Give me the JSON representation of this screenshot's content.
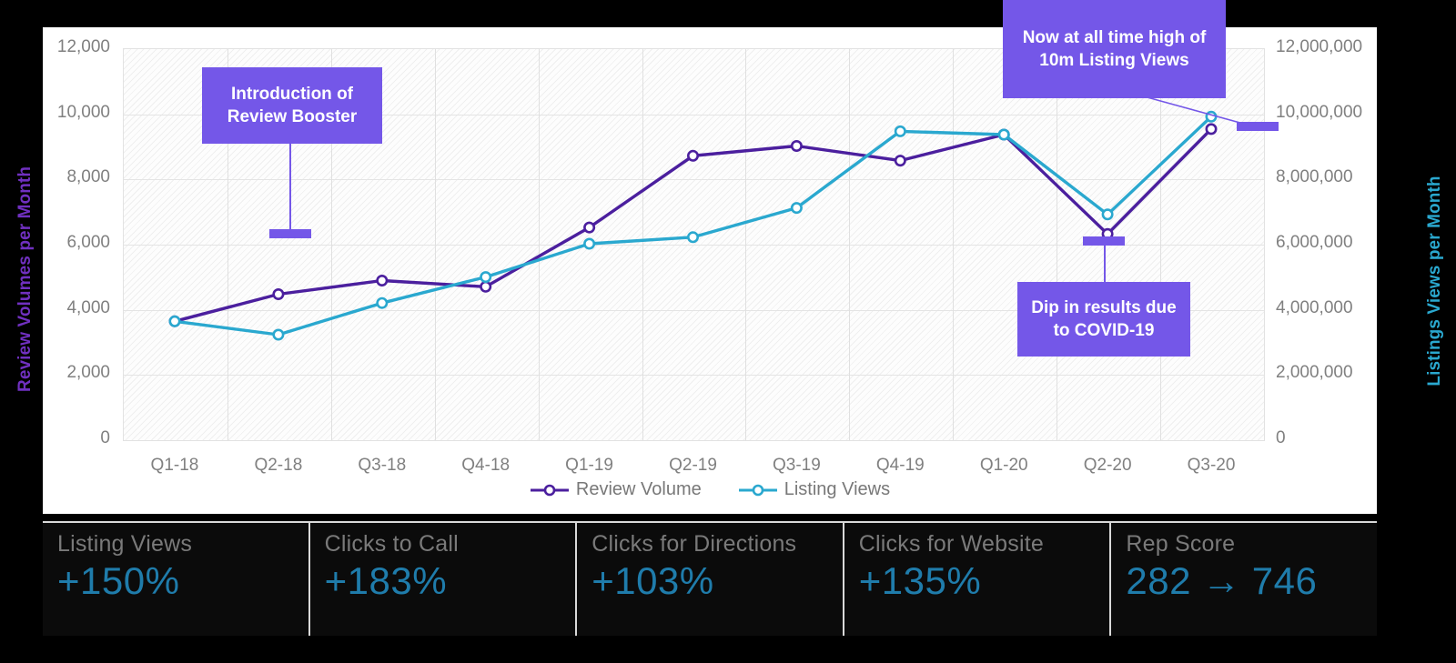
{
  "axis_titles": {
    "left": "Review Volumes per Month",
    "right": "Listings Views per Month"
  },
  "colors": {
    "review_volume": "#4b1f9e",
    "listing_views": "#2aa8cf",
    "annotation_box": "#7457e8",
    "kpi_value": "#1f7cab",
    "kpi_label": "#7a7a7a",
    "tick_text": "#808080"
  },
  "chart_data": {
    "type": "line",
    "title": "",
    "xlabel": "",
    "ylabel": "Review Volumes per Month",
    "y2label": "Listings Views per Month",
    "grid": true,
    "legend_position": "bottom",
    "categories": [
      "Q1-18",
      "Q2-18",
      "Q3-18",
      "Q4-18",
      "Q1-19",
      "Q2-19",
      "Q3-19",
      "Q4-19",
      "Q1-20",
      "Q2-20",
      "Q3-20"
    ],
    "ylim": [
      0,
      12000
    ],
    "yticks": [
      0,
      2000,
      4000,
      6000,
      8000,
      10000,
      12000
    ],
    "ytick_labels": [
      "0",
      "2,000",
      "4,000",
      "6,000",
      "8,000",
      "10,000",
      "12,000"
    ],
    "y2lim": [
      0,
      12000000
    ],
    "y2ticks": [
      0,
      2000000,
      4000000,
      6000000,
      8000000,
      10000000,
      12000000
    ],
    "y2tick_labels": [
      "0",
      "2,000,000",
      "4,000,000",
      "6,000,000",
      "8,000,000",
      "10,000,000",
      "12,000,000"
    ],
    "series": [
      {
        "name": "Review Volume",
        "axis": "left",
        "color": "#4b1f9e",
        "marker": "open-circle",
        "values": [
          3620,
          4450,
          4870,
          4680,
          6500,
          8700,
          9000,
          8550,
          9350,
          6300,
          9520
        ]
      },
      {
        "name": "Listing Views",
        "axis": "right",
        "color": "#2aa8cf",
        "marker": "open-circle",
        "values": [
          3620000,
          3210000,
          4180000,
          4980000,
          6000000,
          6200000,
          7100000,
          9450000,
          9350000,
          6900000,
          9900000
        ]
      }
    ],
    "annotations": [
      {
        "id": "review-booster",
        "text": "Introduction of Review Booster",
        "at_category": "Q1-19",
        "offset": "between Q4-18 and Q1-19"
      },
      {
        "id": "covid-dip",
        "text": "Dip in results due to COVID-19",
        "at_category": "Q2-20"
      },
      {
        "id": "all-time-high",
        "text": "Now at all time high of 10m Listing Views",
        "at_category": "Q3-20"
      }
    ]
  },
  "legend": {
    "items": [
      {
        "label": "Review Volume",
        "color": "#4b1f9e"
      },
      {
        "label": "Listing Views",
        "color": "#2aa8cf"
      }
    ]
  },
  "annotations": {
    "review_booster": "Introduction of Review Booster",
    "covid_dip": "Dip in results due to COVID-19",
    "all_time_high": "Now at all time high of 10m Listing Views"
  },
  "kpis": [
    {
      "label": "Listing Views",
      "value": "+150%"
    },
    {
      "label": "Clicks to Call",
      "value": "+183%"
    },
    {
      "label": "Clicks for Directions",
      "value": "+103%"
    },
    {
      "label": "Clicks for Website",
      "value": "+135%"
    },
    {
      "label": "Rep Score",
      "value": "282 → 746"
    }
  ]
}
